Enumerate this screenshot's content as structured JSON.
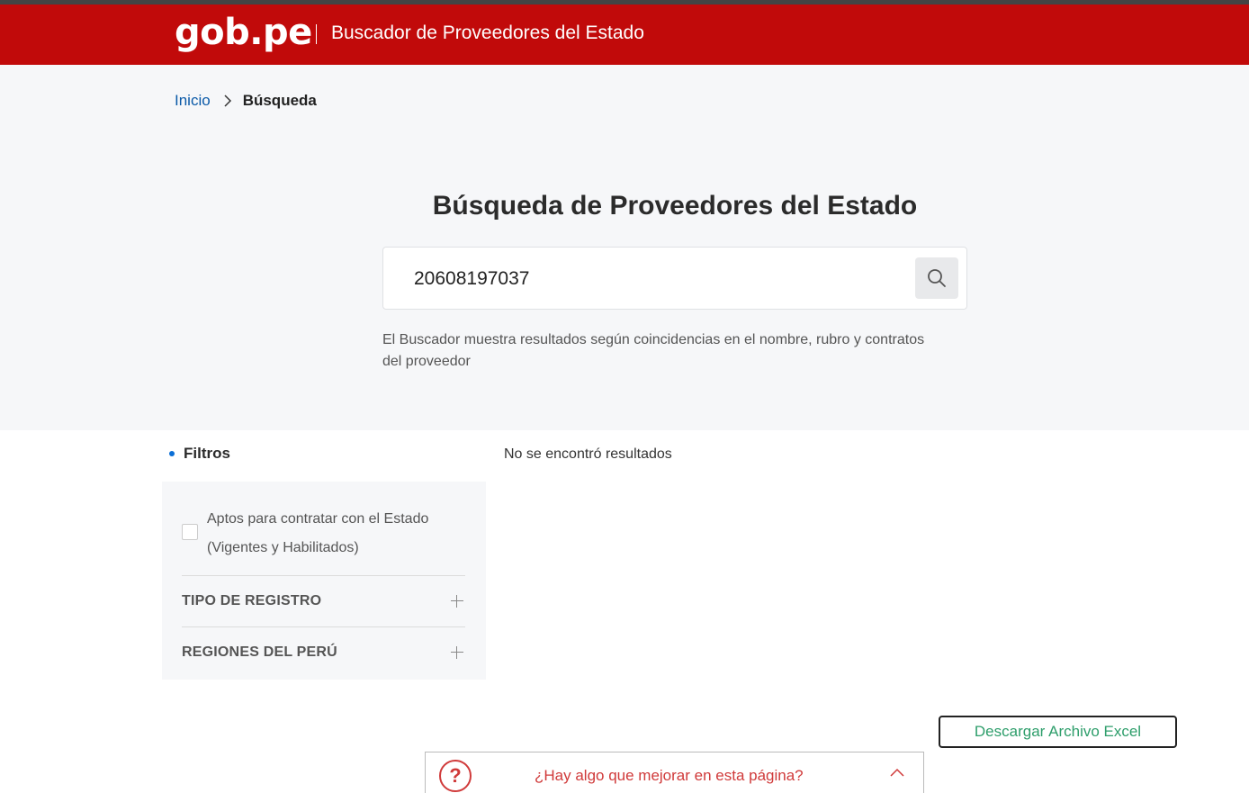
{
  "header": {
    "logo": "gob.pe",
    "title": "Buscador de Proveedores del Estado"
  },
  "breadcrumb": {
    "home": "Inicio",
    "current": "Búsqueda"
  },
  "search": {
    "title": "Búsqueda de Proveedores del Estado",
    "value": "20608197037",
    "help": "El Buscador muestra resultados según coincidencias en el nombre, rubro y contratos del proveedor"
  },
  "filters": {
    "title": "Filtros",
    "apt_checkbox_label": "Aptos para contratar con el Estado (Vigentes y Habilitados)",
    "sections": [
      "TIPO DE REGISTRO",
      "REGIONES DEL PERÚ"
    ]
  },
  "results": {
    "empty_message": "No se encontró resultados"
  },
  "download": {
    "label": "Descargar Archivo Excel"
  },
  "feedback": {
    "question": "¿Hay algo que mejorar en esta página?",
    "icon": "?"
  },
  "colors": {
    "brand_red": "#c10a0a",
    "link_blue": "#0b5aa8",
    "download_green": "#2e9e6b",
    "feedback_red": "#d03a3a"
  }
}
